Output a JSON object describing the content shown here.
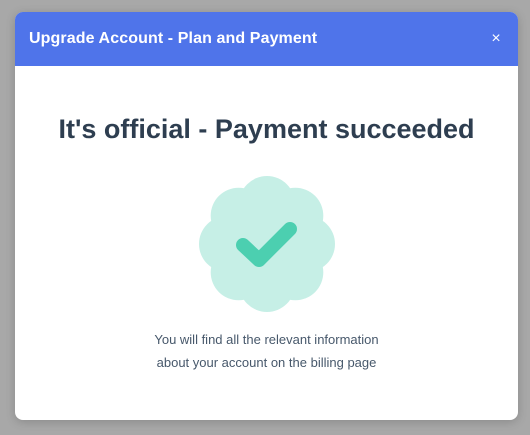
{
  "dialog": {
    "title": "Upgrade Account - Plan and Payment",
    "close_label": "×",
    "headline": "It's official - Payment succeeded",
    "message_line1": "You will find all the relevant information",
    "message_line2": "about your account on the billing page",
    "badge_icon": "checkmark-badge-icon"
  },
  "colors": {
    "header": "#4f74ea",
    "badge_fill": "#c6efe6",
    "checkmark": "#4ccfb0",
    "headline_text": "#2e3e50",
    "backdrop": "#a8a8a8"
  }
}
